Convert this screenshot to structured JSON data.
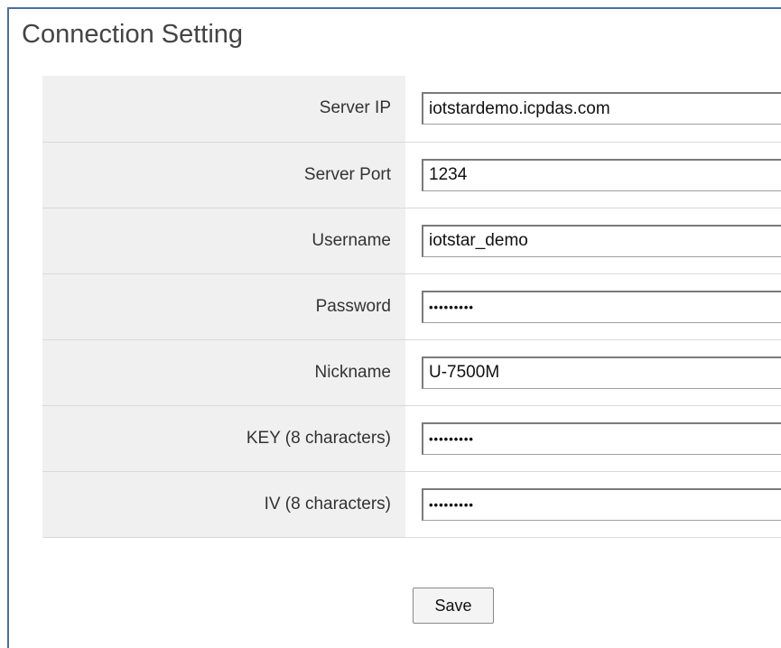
{
  "panel": {
    "title": "Connection Setting"
  },
  "form": {
    "fields": [
      {
        "label": "Server IP",
        "value": "iotstardemo.icpdas.com",
        "type": "text"
      },
      {
        "label": "Server Port",
        "value": "1234",
        "type": "text"
      },
      {
        "label": "Username",
        "value": "iotstar_demo",
        "type": "text"
      },
      {
        "label": "Password",
        "value": "•••••••••",
        "type": "password"
      },
      {
        "label": "Nickname",
        "value": "U-7500M",
        "type": "text"
      },
      {
        "label": "KEY (8 characters)",
        "value": "•••••••••",
        "type": "password"
      },
      {
        "label": "IV (8 characters)",
        "value": "•••••••••",
        "type": "password"
      }
    ]
  },
  "actions": {
    "save_label": "Save"
  }
}
